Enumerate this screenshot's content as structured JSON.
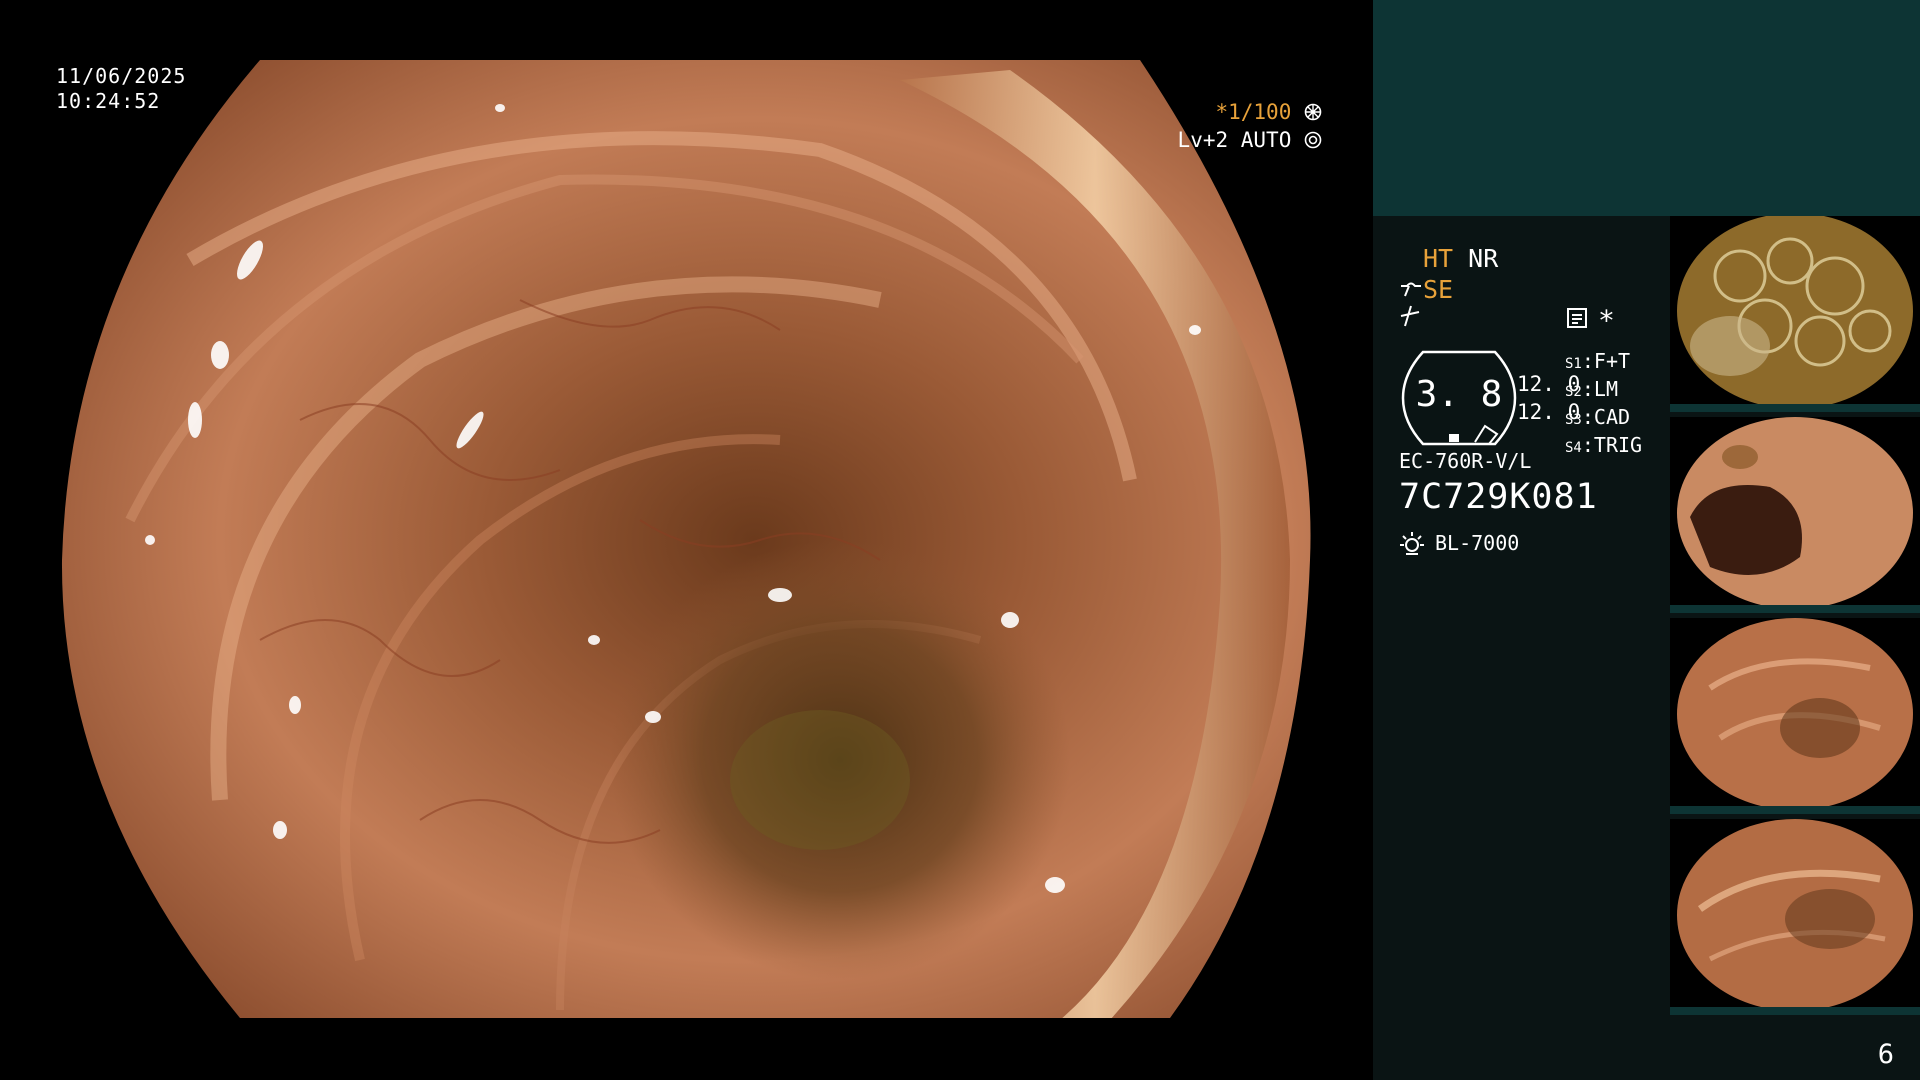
{
  "overlay": {
    "date": "11/06/2025",
    "time": "10:24:52",
    "exposure": "*1/100",
    "exposure_icon": "aperture-icon",
    "level": "Lv+2 AUTO",
    "level_icon": "iris-icon"
  },
  "panel": {
    "ht": "HT",
    "nr": "NR",
    "se": "SE",
    "gauge_value": "3. 8",
    "side_value_1": "12. 0",
    "side_value_2": "12. 0",
    "s1_label": "S1",
    "s1_value": "F+T",
    "s2_label": "S2",
    "s2_value": "LM",
    "s3_label": "S3",
    "s3_value": "CAD",
    "s4_label": "S4",
    "s4_value": "TRIG",
    "asterisk": "*",
    "scope_model": "EC-760R-V/L",
    "serial": "7C729K081",
    "light_source": "BL-7000",
    "page_number": "6"
  },
  "colors": {
    "accent_orange": "#e8a23a",
    "panel_teal": "#0d3434",
    "panel_dark": "#0a1414"
  },
  "thumbnails": [
    {
      "name": "thumbnail-1"
    },
    {
      "name": "thumbnail-2"
    },
    {
      "name": "thumbnail-3"
    },
    {
      "name": "thumbnail-4"
    }
  ]
}
